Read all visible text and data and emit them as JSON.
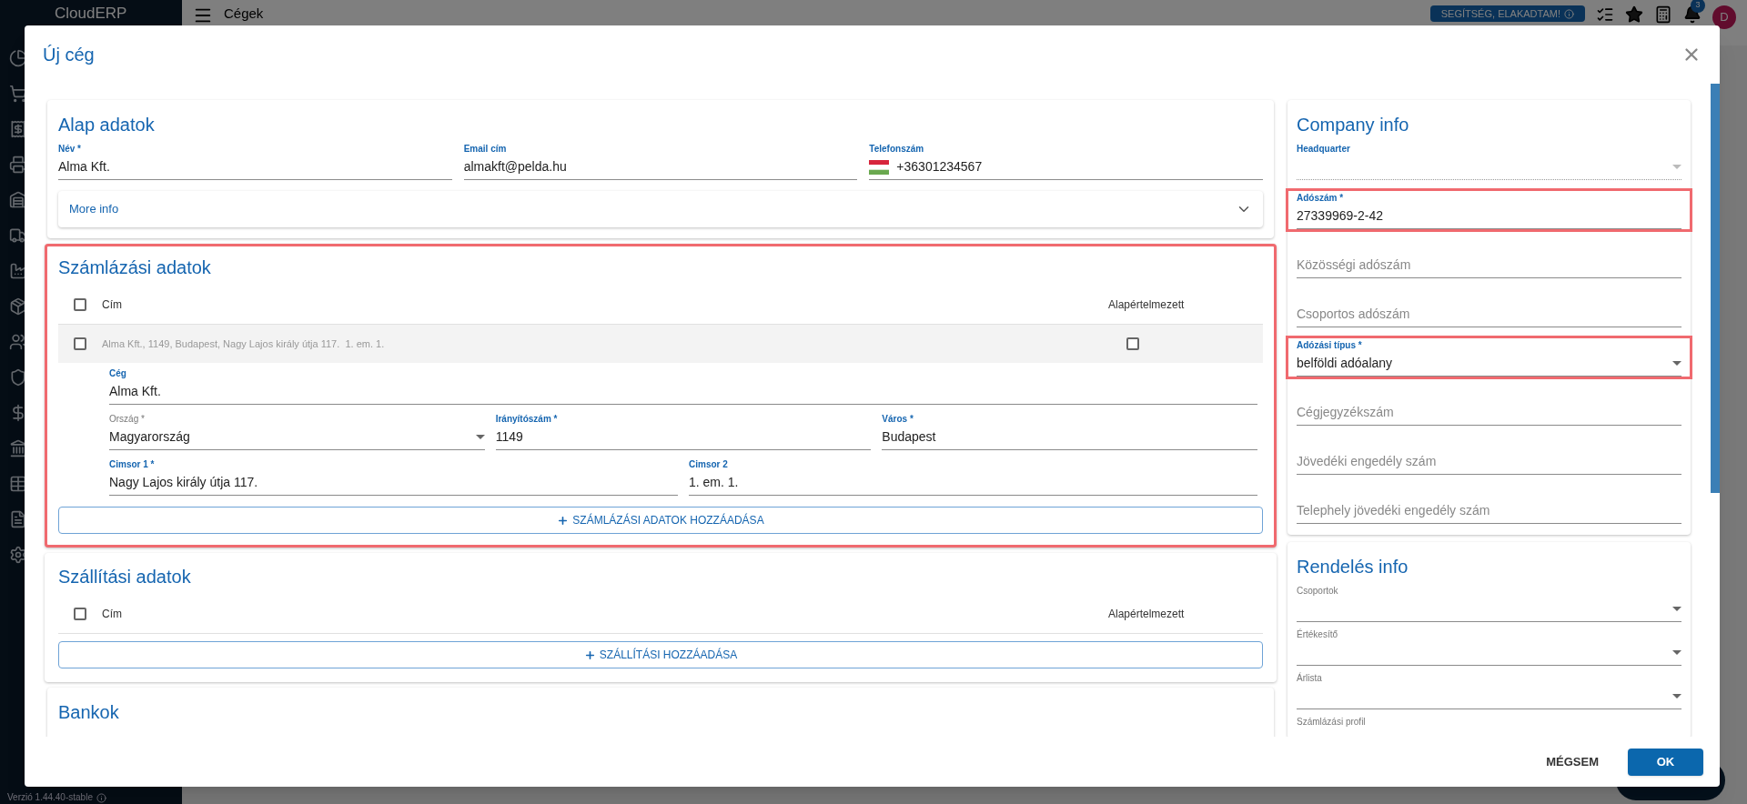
{
  "app": {
    "logo": "CloudERP",
    "page_title": "Cégek",
    "help_button": "SEGÍTSÉG, ELAKADTAM!",
    "notification_count": "3",
    "avatar": "D",
    "version": "Verzió 1.44.40-stable"
  },
  "dialog": {
    "title": "Új cég",
    "basic": {
      "title": "Alap adatok",
      "fields": [
        {
          "kind": "text",
          "label": "Név *",
          "value": "Alma Kft.",
          "active": true
        },
        {
          "kind": "text",
          "label": "Email cím",
          "value": "almakft@pelda.hu",
          "active": true
        },
        {
          "kind": "phone",
          "label": "Telefonszám",
          "value": "+36301234567",
          "active": true
        }
      ],
      "more_info": {
        "label": "More info",
        "expanded": false
      }
    },
    "billing": {
      "title": "Számlázási adatok",
      "highlighted": true,
      "columns": [
        "Cím",
        "Alapértelmezett"
      ],
      "all_checked": false,
      "rows": [
        {
          "checked": false,
          "address": "Alma Kft., 1149, Budapest, Nagy Lajos király útja 117.  1. em. 1.",
          "default": false,
          "expanded": true,
          "fields": [
            [
              {
                "kind": "text",
                "label": "Cég",
                "value": "Alma Kft.",
                "active": true
              }
            ],
            [
              {
                "kind": "select",
                "label": "Ország *",
                "value": "Magyarország",
                "active": false
              },
              {
                "kind": "text",
                "label": "Irányítószám *",
                "value": "1149",
                "active": true
              },
              {
                "kind": "text",
                "label": "Város *",
                "value": "Budapest",
                "active": true
              }
            ],
            [
              {
                "kind": "text",
                "label": "Cimsor 1 *",
                "value": "Nagy Lajos király útja 117.",
                "active": true
              },
              {
                "kind": "text",
                "label": "Cimsor 2",
                "value": "1. em. 1.",
                "active": true
              }
            ]
          ]
        }
      ],
      "add_button": "SZÁMLÁZÁSI ADATOK HOZZÁADÁSA"
    },
    "shipping": {
      "title": "Szállítási adatok",
      "highlighted": false,
      "columns": [
        "Cím",
        "Alapértelmezett"
      ],
      "all_checked": false,
      "add_button": "SZÁLLÍTÁSI HOZZÁADÁSA"
    },
    "banks": {
      "title": "Bankok"
    },
    "company_info": {
      "title": "Company info",
      "fields": [
        {
          "kind": "select",
          "label": "Headquarter",
          "active": true,
          "disabled": true,
          "highlighted": false
        },
        {
          "kind": "text",
          "label": "Adószám *",
          "value": "27339969-2-42",
          "active": true,
          "highlighted": true
        },
        {
          "kind": "text",
          "label": "Közösségi adószám",
          "active": false,
          "highlighted": false
        },
        {
          "kind": "text",
          "label": "Csoportos adószám",
          "active": false,
          "highlighted": false
        },
        {
          "kind": "select",
          "label": "Adózási típus *",
          "value": "belföldi adóalany",
          "active": true,
          "highlighted": true
        },
        {
          "kind": "text",
          "label": "Cégjegyzékszám",
          "active": false,
          "highlighted": false
        },
        {
          "kind": "text",
          "label": "Jövedéki engedély szám",
          "active": false,
          "highlighted": false
        },
        {
          "kind": "text",
          "label": "Telephely jövedéki engedély szám",
          "active": false,
          "highlighted": false
        }
      ]
    },
    "order_info": {
      "title": "Rendelés info",
      "fields": [
        {
          "kind": "select",
          "label": "Csoportok",
          "active": false
        },
        {
          "kind": "select",
          "label": "Értékesítő",
          "active": false
        },
        {
          "kind": "select",
          "label": "Árlista",
          "active": false
        },
        {
          "kind": "cut",
          "label": "Számlázási profil",
          "active": false
        }
      ]
    },
    "buttons": [
      {
        "label": "MÉGSEM",
        "kind": "text"
      },
      {
        "label": "OK",
        "kind": "primary"
      }
    ]
  }
}
